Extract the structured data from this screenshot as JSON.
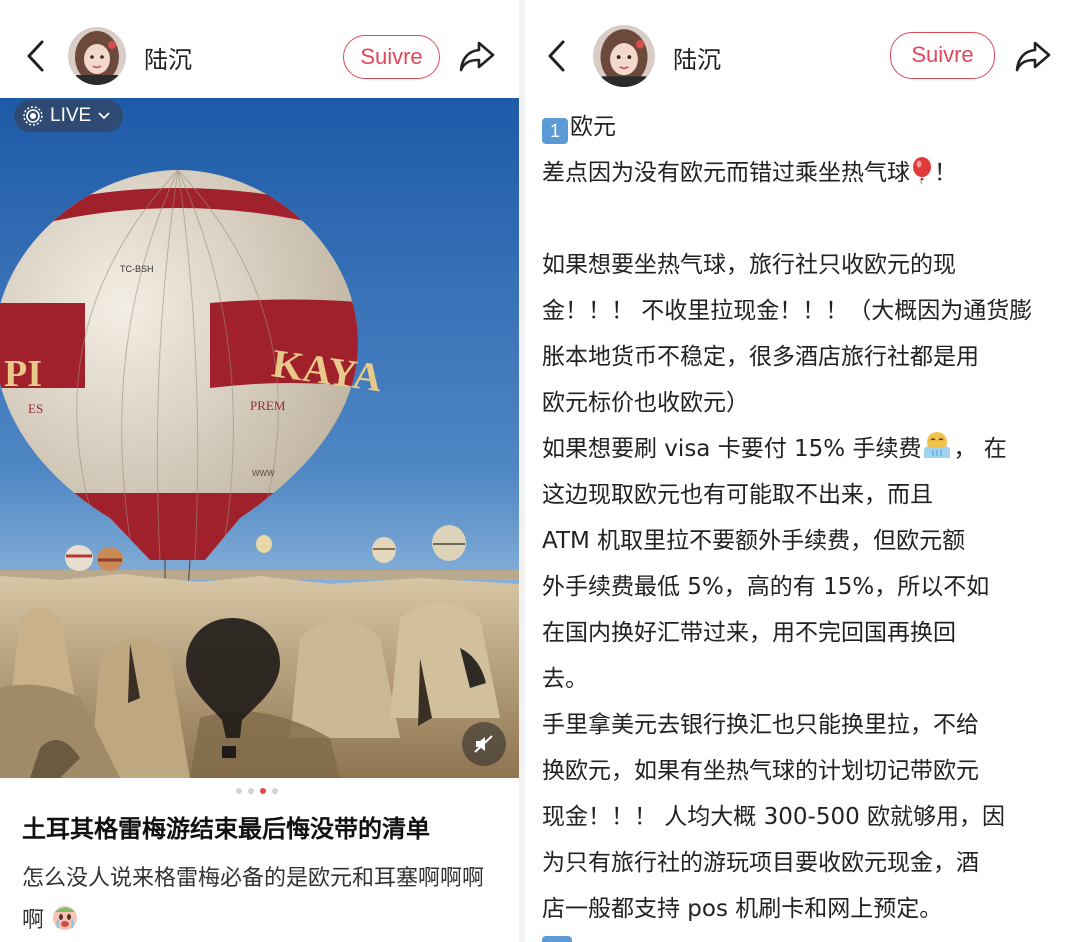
{
  "left": {
    "author": "陆沉",
    "follow_label": "Suivre",
    "live_label": "LIVE",
    "balloon_reg": "TC-BSH",
    "balloon_brand_left": "PI",
    "balloon_brand_right": "KAYA",
    "balloon_sub": "PREM",
    "balloon_sub_left": "ES",
    "balloon_www": "WWW",
    "title": "土耳其格雷梅游结束最后悔没带的清单",
    "desc": "怎么没人说来格雷梅必备的是欧元和耳塞啊啊啊啊",
    "pagination": {
      "total": 4,
      "active": 3
    }
  },
  "right": {
    "author": "陆沉",
    "follow_label": "Suivre",
    "keycap_number": "1",
    "lines": [
      "欧元",
      "差点因为没有欧元而错过乘坐热气球",
      "！",
      "",
      "如果想要坐热气球，旅行社只收欧元的现",
      "金！！！ 不收里拉现金！！！（大概因为通货膨",
      "胀本地货币不稳定，很多酒店旅行社都是用",
      "欧元标价也收欧元）",
      "如果想要刷 visa 卡要付 15% 手续费",
      "， 在",
      "这边现取欧元也有可能取不出来，而且",
      " ATM 机取里拉不要额外手续费，但欧元额",
      "外手续费最低 5%，高的有 15%，所以不如",
      "在国内换好汇带过来，用不完回国再换回",
      "去。",
      "手里拿美元去银行换汇也只能换里拉，不给",
      "换欧元，如果有坐热气球的计划切记带欧元",
      "现金！！！ 人均大概 300-500 欧就够用，因",
      "为只有旅行社的游玩项目要收欧元现金，酒",
      "店一般都支持 pos 机刷卡和网上预定。"
    ]
  },
  "colors": {
    "accent": "#e0485a",
    "sky_top": "#1f5fae",
    "sky_bottom": "#8db6dc",
    "balloon_red": "#a0202c",
    "balloon_cream": "#e8e2d6",
    "keycap": "#5b9bd5"
  },
  "icons": [
    "back-chevron-icon",
    "share-arrow-icon",
    "live-icon",
    "chevron-down-icon",
    "mute-icon",
    "balloon-emoji-icon",
    "crying-emoji-icon",
    "hand-emoji-icon"
  ]
}
